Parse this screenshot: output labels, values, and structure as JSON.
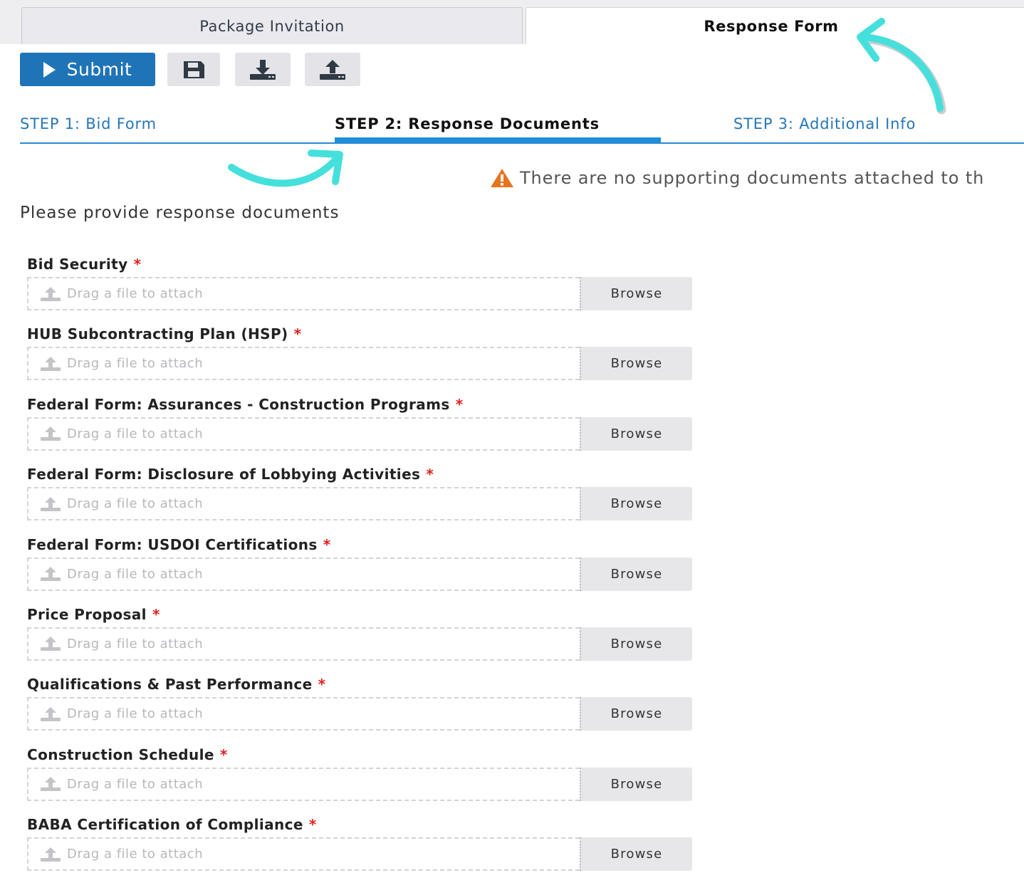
{
  "top_tabs": {
    "package_invitation": "Package Invitation",
    "response_form": "Response Form"
  },
  "toolbar": {
    "submit_label": "Submit",
    "save_icon": "save-icon",
    "download_icon": "download-icon",
    "upload_icon": "upload-icon"
  },
  "steps": [
    {
      "label": "STEP 1: Bid Form"
    },
    {
      "label": "STEP 2: Response Documents"
    },
    {
      "label": "STEP 3: Additional Info"
    }
  ],
  "warning": {
    "text": "There are no supporting documents attached to th",
    "icon": "warning-icon",
    "color": "#e8741d"
  },
  "intro": "Please provide response documents",
  "fields": [
    {
      "label": "Bid Security",
      "required_mark": "*",
      "placeholder": "Drag a file to attach",
      "browse": "Browse"
    },
    {
      "label": "HUB Subcontracting Plan (HSP)",
      "required_mark": "*",
      "placeholder": "Drag a file to attach",
      "browse": "Browse"
    },
    {
      "label": "Federal Form: Assurances - Construction Programs",
      "required_mark": "*",
      "placeholder": "Drag a file to attach",
      "browse": "Browse"
    },
    {
      "label": "Federal Form: Disclosure of Lobbying Activities",
      "required_mark": "*",
      "placeholder": "Drag a file to attach",
      "browse": "Browse"
    },
    {
      "label": "Federal Form: USDOI Certifications",
      "required_mark": "*",
      "placeholder": "Drag a file to attach",
      "browse": "Browse"
    },
    {
      "label": "Price Proposal",
      "required_mark": "*",
      "placeholder": "Drag a file to attach",
      "browse": "Browse"
    },
    {
      "label": "Qualifications & Past Performance",
      "required_mark": "*",
      "placeholder": "Drag a file to attach",
      "browse": "Browse"
    },
    {
      "label": "Construction Schedule",
      "required_mark": "*",
      "placeholder": "Drag a file to attach",
      "browse": "Browse"
    },
    {
      "label": "BABA Certification of Compliance",
      "required_mark": "*",
      "placeholder": "Drag a file to attach",
      "browse": "Browse"
    }
  ],
  "colors": {
    "primary": "#1f74b8",
    "step_active_underline": "#1e8fd8",
    "required": "#e0201b",
    "annotation_arrow": "#45e0dc"
  }
}
